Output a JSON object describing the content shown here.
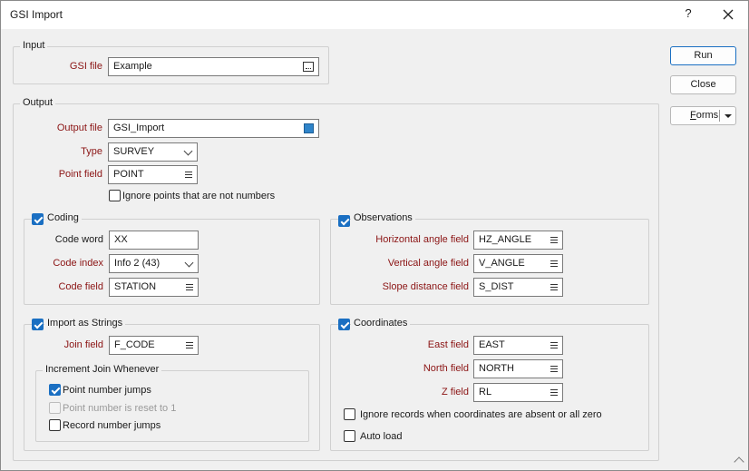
{
  "window": {
    "title": "GSI Import",
    "help_label": "?"
  },
  "input_group": {
    "legend": "Input",
    "gsi_file_label": "GSI file",
    "gsi_file_value": "Example"
  },
  "output_group": {
    "legend": "Output",
    "output_file_label": "Output file",
    "output_file_value": "GSI_Import",
    "type_label": "Type",
    "type_value": "SURVEY",
    "point_field_label": "Point field",
    "point_field_value": "POINT",
    "ignore_points_label": "Ignore points that are not numbers"
  },
  "coding": {
    "legend": "Coding",
    "code_word_label": "Code word",
    "code_word_value": "XX",
    "code_index_label": "Code index",
    "code_index_value": "Info 2 (43)",
    "code_field_label": "Code field",
    "code_field_value": "STATION"
  },
  "observations": {
    "legend": "Observations",
    "hz_label": "Horizontal angle field",
    "hz_value": "HZ_ANGLE",
    "v_label": "Vertical angle field",
    "v_value": "V_ANGLE",
    "s_label": "Slope distance field",
    "s_value": "S_DIST"
  },
  "import_strings": {
    "legend": "Import as Strings",
    "join_field_label": "Join field",
    "join_field_value": "F_CODE",
    "increment_legend": "Increment Join Whenever",
    "point_jumps_label": "Point number jumps",
    "point_reset_label": "Point number is reset to 1",
    "record_jumps_label": "Record number jumps"
  },
  "coordinates": {
    "legend": "Coordinates",
    "east_label": "East field",
    "east_value": "EAST",
    "north_label": "North field",
    "north_value": "NORTH",
    "z_label": "Z field",
    "z_value": "RL",
    "ignore_records_label": "Ignore records when coordinates are absent or all zero",
    "auto_load_label": "Auto load"
  },
  "buttons": {
    "run": "Run",
    "close": "Close",
    "forms_prefix": "F",
    "forms_rest": "orms"
  },
  "colors": {
    "accent": "#1a6fc2",
    "required_label": "#8b1414"
  }
}
